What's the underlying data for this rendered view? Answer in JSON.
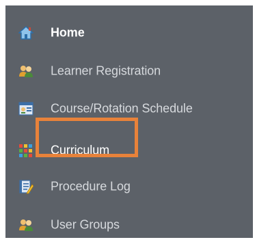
{
  "sidebar": {
    "items": [
      {
        "label": "Home",
        "icon": "home-icon",
        "state": "active"
      },
      {
        "label": "Learner Registration",
        "icon": "users-icon",
        "state": "normal"
      },
      {
        "label": "Course/Rotation Schedule",
        "icon": "schedule-icon",
        "state": "normal"
      },
      {
        "label": "Curriculum",
        "icon": "grid-icon",
        "state": "current"
      },
      {
        "label": "Procedure Log",
        "icon": "log-icon",
        "state": "normal"
      },
      {
        "label": "User Groups",
        "icon": "users-icon",
        "state": "normal"
      }
    ]
  },
  "colors": {
    "sidebar_bg": "#5c6168",
    "label": "#d6d9dd",
    "label_active": "#ffffff",
    "highlight": "#e8823a"
  }
}
